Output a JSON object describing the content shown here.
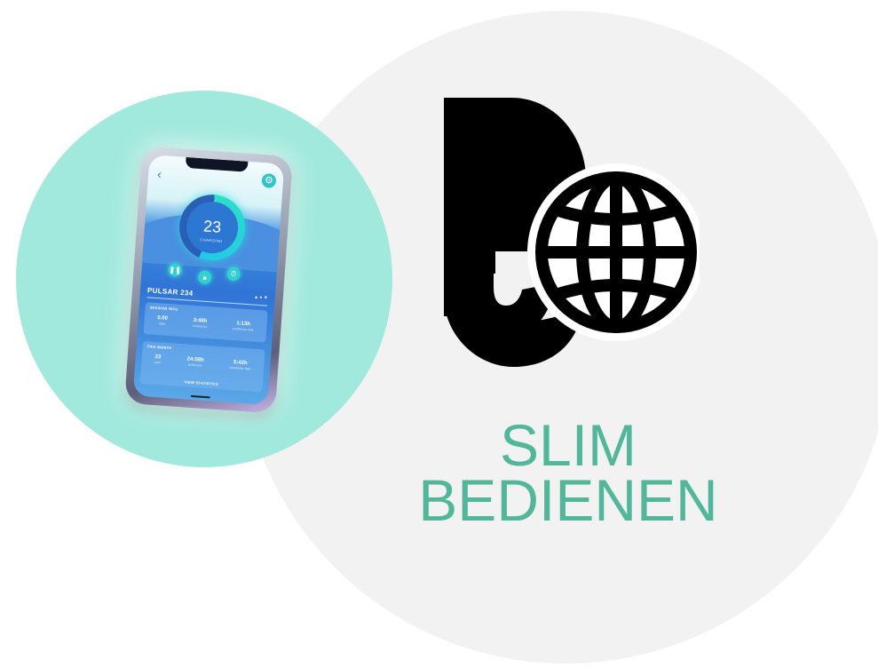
{
  "headline": {
    "line1": "SLIM",
    "line2": "BEDIENEN"
  },
  "icon": {
    "name": "touch-globe-icon"
  },
  "colors": {
    "accent_text": "#52b79a",
    "mint_circle": "#a2e9dd",
    "grey_circle": "#f2f2f2"
  },
  "phone_app": {
    "gauge_number": "23",
    "gauge_sublabel": "CHARGING",
    "device_name": "PULSAR 234",
    "card1": {
      "title": "SESSION INFO",
      "stats": [
        {
          "value": "0.00",
          "label": "KWH"
        },
        {
          "value": "3:48h",
          "label": "DURATION"
        },
        {
          "value": "1:13h",
          "label": "CHARGING TIME"
        }
      ]
    },
    "card2": {
      "title": "THIS MONTH",
      "stats": [
        {
          "value": "23",
          "label": "KWH"
        },
        {
          "value": "24:58h",
          "label": "DURATION"
        },
        {
          "value": "5:42h",
          "label": "CHARGING TIME"
        }
      ],
      "footer": "VIEW STATISTICS"
    }
  }
}
